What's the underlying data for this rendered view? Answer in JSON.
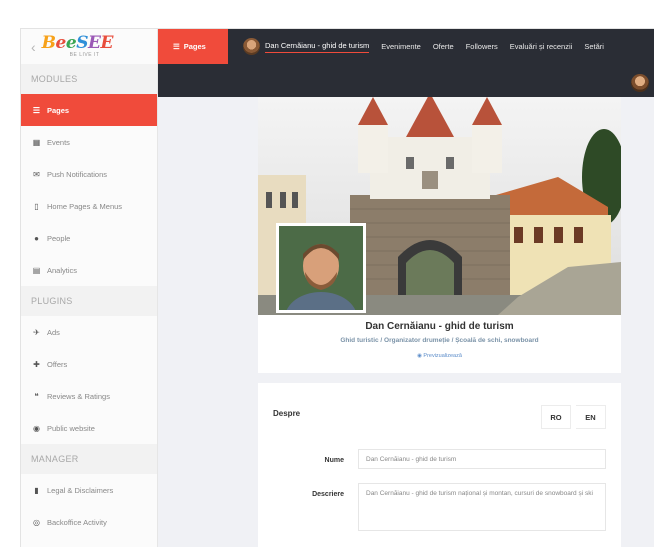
{
  "sidebar": {
    "logo_text": "BeeSEE",
    "logo_tagline": "BE LIVE IT",
    "sections": {
      "modules": "MODULES",
      "plugins": "PLUGINS",
      "manager": "MANAGER"
    },
    "modules": [
      {
        "label": "Pages",
        "icon": "list-icon",
        "active": true
      },
      {
        "label": "Events",
        "icon": "calendar-icon"
      },
      {
        "label": "Push Notifications",
        "icon": "envelope-icon"
      },
      {
        "label": "Home Pages & Menus",
        "icon": "mobile-icon"
      },
      {
        "label": "People",
        "icon": "user-icon"
      },
      {
        "label": "Analytics",
        "icon": "chart-icon"
      }
    ],
    "plugins": [
      {
        "label": "Ads",
        "icon": "plane-icon"
      },
      {
        "label": "Offers",
        "icon": "puzzle-icon"
      },
      {
        "label": "Reviews & Ratings",
        "icon": "comments-icon"
      },
      {
        "label": "Public website",
        "icon": "globe-icon"
      }
    ],
    "manager": [
      {
        "label": "Legal & Disclaimers",
        "icon": "document-icon"
      },
      {
        "label": "Backoffice Activity",
        "icon": "eye-icon"
      }
    ]
  },
  "topbar": {
    "pages_tab": "Pages",
    "items": [
      "Dan Cernăianu - ghid de turism",
      "Evenimente",
      "Oferte",
      "Followers",
      "Evaluări și recenzii",
      "Setări"
    ]
  },
  "profile": {
    "name": "Dan Cernăianu - ghid de turism",
    "tagline": "Ghid turistic / Organizator drumeție / Școală de schi, snowboard",
    "preview": "Previzualizează"
  },
  "about": {
    "title": "Despre",
    "languages": [
      "RO",
      "EN"
    ],
    "fields": [
      {
        "label": "Nume",
        "value": "Dan Cernăianu - ghid de turism"
      },
      {
        "label": "Descriere",
        "value": "Dan Cernăianu - ghid de turism național și montan, cursuri de snowboard și ski"
      }
    ]
  },
  "colors": {
    "accent": "#f04b3b",
    "topbar_bg": "#2a2d35",
    "tagline": "#7b93a8",
    "link": "#5b8cc9"
  }
}
